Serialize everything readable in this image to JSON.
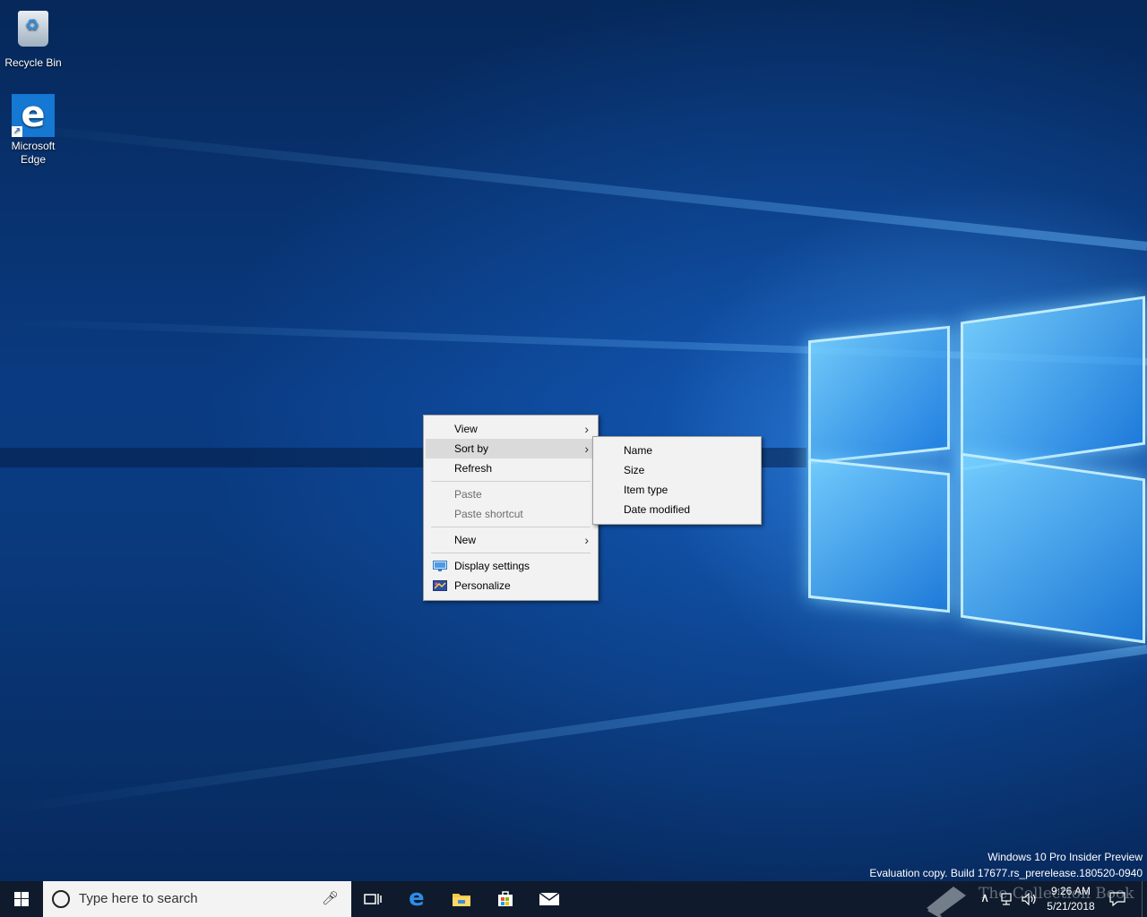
{
  "desktop_icons": [
    {
      "label": "Recycle Bin",
      "icon": "recycle-bin-icon"
    },
    {
      "label": "Microsoft\nEdge",
      "icon": "edge-icon"
    }
  ],
  "watermark": {
    "line1": "Windows 10 Pro Insider Preview",
    "line2": "Evaluation copy. Build 17677.rs_prerelease.180520-0940"
  },
  "context_menu": {
    "items": [
      {
        "label": "View",
        "submenu": true
      },
      {
        "label": "Sort by",
        "submenu": true,
        "highlighted": true
      },
      {
        "label": "Refresh"
      },
      {
        "label": "Paste",
        "disabled": true
      },
      {
        "label": "Paste shortcut",
        "disabled": true
      },
      {
        "label": "New",
        "submenu": true
      },
      {
        "label": "Display settings",
        "icon": "display-settings-icon"
      },
      {
        "label": "Personalize",
        "icon": "personalize-icon"
      }
    ]
  },
  "sort_submenu": {
    "items": [
      "Name",
      "Size",
      "Item type",
      "Date modified"
    ]
  },
  "taskbar": {
    "search_placeholder": "Type here to search",
    "pinned": [
      "task-view-icon",
      "edge-icon",
      "file-explorer-icon",
      "store-icon",
      "mail-icon"
    ],
    "clock_time": "9:26 AM",
    "clock_date": "5/21/2018",
    "overlay_text": "The Collection Book"
  },
  "colors": {
    "taskbar": "#0f1b2c",
    "menu_bg": "#f2f2f2",
    "menu_highlight": "#dadada",
    "accent_blue": "#1578d2"
  }
}
